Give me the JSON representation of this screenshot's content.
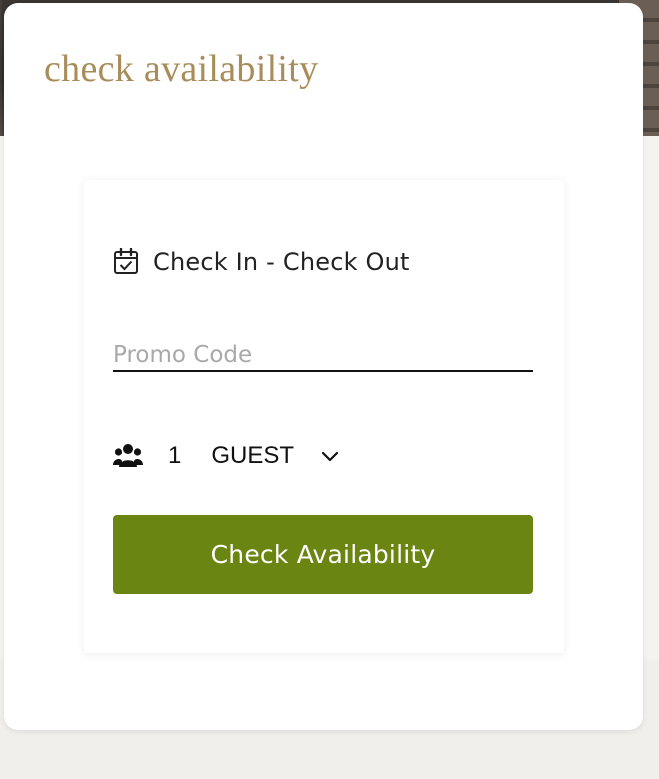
{
  "colors": {
    "title": "#a88d5a",
    "button_bg": "#6b8512",
    "button_text": "#ffffff",
    "placeholder": "#a9a9a9"
  },
  "card": {
    "title": "check availability"
  },
  "widget": {
    "dates": {
      "icon": "calendar-check-icon",
      "label": "Check In - Check Out"
    },
    "promo": {
      "placeholder": "Promo Code",
      "value": ""
    },
    "guests": {
      "icon": "users-icon",
      "count": "1",
      "unit": "GUEST",
      "dropdown_icon": "chevron-down-icon"
    },
    "submit_label": "Check Availability"
  }
}
